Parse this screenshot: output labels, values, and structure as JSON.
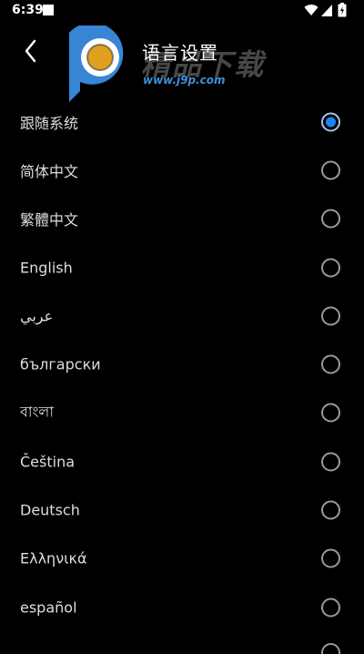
{
  "status_bar": {
    "time": "6:39",
    "icons": [
      "notification-square-icon",
      "wifi-icon",
      "signal-icon",
      "battery-charging-icon"
    ]
  },
  "app_bar": {
    "title": "语言设置",
    "back_icon": "back-arrow-icon"
  },
  "watermark": {
    "text": "精品下载",
    "url": "www.j9p.com",
    "logo_colors": [
      "#3a8de0",
      "#e0a020"
    ]
  },
  "colors": {
    "accent": "#1a86f0",
    "background": "#000000",
    "text": "#dedede"
  },
  "languages": [
    {
      "label": "跟随系统",
      "selected": true
    },
    {
      "label": "简体中文",
      "selected": false
    },
    {
      "label": "繁體中文",
      "selected": false
    },
    {
      "label": "English",
      "selected": false
    },
    {
      "label": "عربي",
      "selected": false
    },
    {
      "label": "български",
      "selected": false
    },
    {
      "label": "বাংলা",
      "selected": false
    },
    {
      "label": "Čeština",
      "selected": false
    },
    {
      "label": "Deutsch",
      "selected": false
    },
    {
      "label": "Ελληνικά",
      "selected": false
    },
    {
      "label": "español",
      "selected": false
    }
  ]
}
